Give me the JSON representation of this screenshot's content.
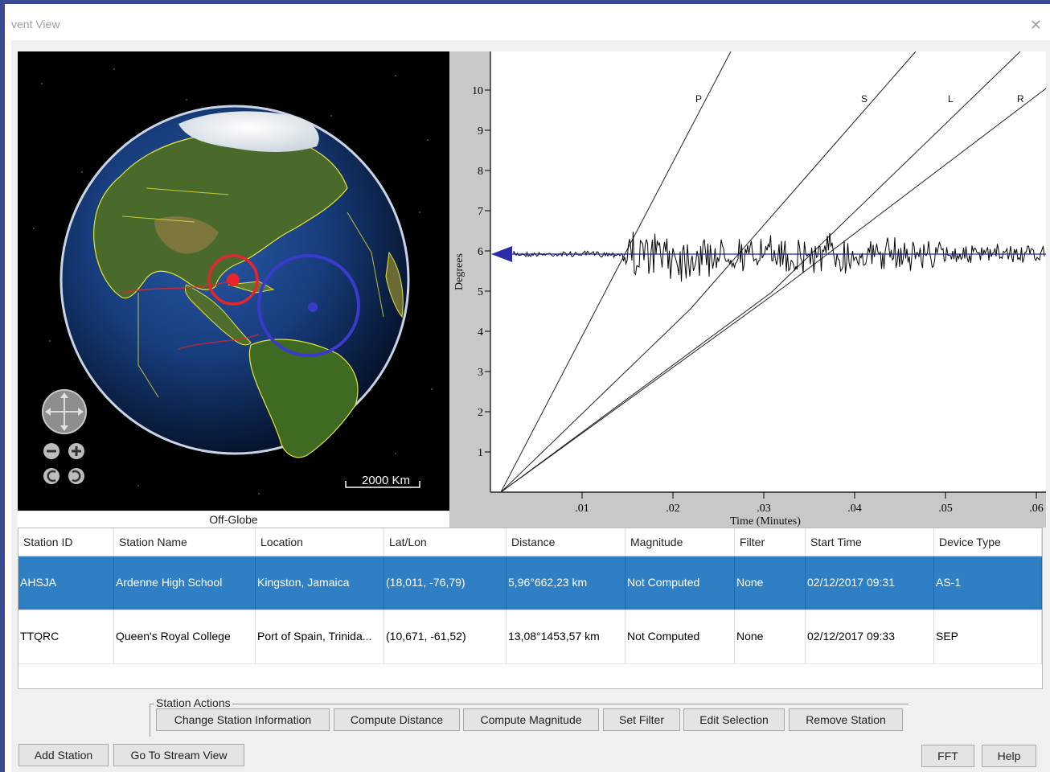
{
  "window": {
    "title": "vent View"
  },
  "globe": {
    "scale_label": "2000 Km",
    "off_globe_label": "Off-Globe",
    "colors": {
      "epicenter": "#e8242c",
      "station_ring": "#3a3acd"
    }
  },
  "seismogram": {
    "ylabel": "Degrees",
    "xlabel": "Time (Minutes)",
    "y_ticks": [
      "1",
      "2",
      "3",
      "4",
      "5",
      "6",
      "7",
      "8",
      "9",
      "10"
    ],
    "x_ticks": [
      ".01",
      ".02",
      ".03",
      ".04",
      ".05",
      ".06"
    ],
    "phase_labels": [
      "P",
      "S",
      "L",
      "R"
    ]
  },
  "table": {
    "headers": [
      "Station ID",
      "Station Name",
      "Location",
      "Lat/Lon",
      "Distance",
      "Magnitude",
      "Filter",
      "Start Time",
      "Device Type"
    ],
    "rows": [
      {
        "selected": true,
        "cells": [
          "AHSJA",
          "Ardenne High School",
          "Kingston, Jamaica",
          "(18,011, -76,79)",
          "5,96°662,23 km",
          "Not Computed",
          "None",
          "02/12/2017 09:31",
          "AS-1"
        ]
      },
      {
        "selected": false,
        "cells": [
          "TTQRC",
          "Queen's Royal College",
          "Port of Spain, Trinida...",
          "(10,671, -61,52)",
          "13,08°1453,57 km",
          "Not Computed",
          "None",
          "02/12/2017 09:33",
          "SEP"
        ]
      }
    ]
  },
  "station_actions": {
    "label": "Station Actions",
    "buttons": [
      "Change Station Information",
      "Compute Distance",
      "Compute Magnitude",
      "Set Filter",
      "Edit Selection",
      "Remove Station"
    ]
  },
  "bottom_buttons": {
    "add_station": "Add Station",
    "go_to_stream": "Go To Stream View",
    "fft": "FFT",
    "help": "Help"
  }
}
